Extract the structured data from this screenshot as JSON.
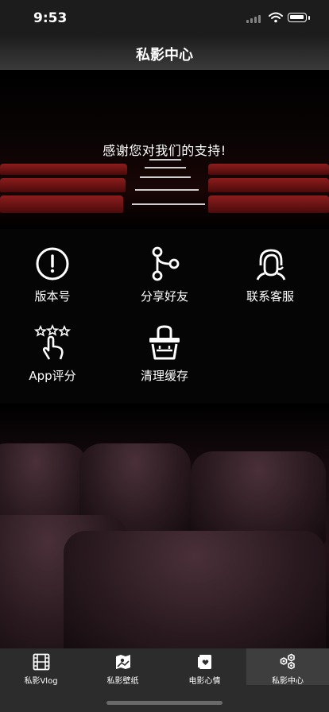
{
  "status_bar": {
    "time": "9:53"
  },
  "nav": {
    "title": "私影中心"
  },
  "main": {
    "thanks_text": "感谢您对我们的支持!",
    "menu": [
      {
        "label": "版本号",
        "icon": "info-circle-icon"
      },
      {
        "label": "分享好友",
        "icon": "share-branch-icon"
      },
      {
        "label": "联系客服",
        "icon": "customer-service-icon"
      },
      {
        "label": "App评分",
        "icon": "rating-stars-hand-icon"
      },
      {
        "label": "清理缓存",
        "icon": "clear-cache-basket-icon"
      }
    ]
  },
  "tab_bar": {
    "tabs": [
      {
        "label": "私影Vlog",
        "icon": "film-icon"
      },
      {
        "label": "私影壁纸",
        "icon": "wallpaper-icon"
      },
      {
        "label": "电影心情",
        "icon": "mood-card-icon"
      },
      {
        "label": "私影中心",
        "icon": "hexagons-icon"
      }
    ],
    "active_index": 3
  }
}
